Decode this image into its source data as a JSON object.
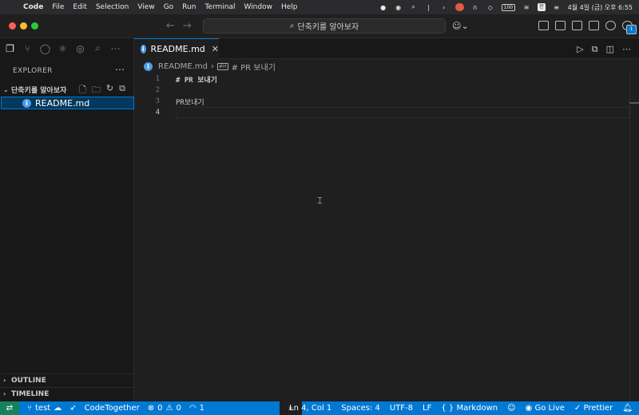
{
  "menubar": {
    "items": [
      "Code",
      "File",
      "Edit",
      "Selection",
      "View",
      "Go",
      "Run",
      "Terminal",
      "Window",
      "Help"
    ],
    "ime": "한",
    "clock": "4월 4일 (금) 오후 6:55",
    "battery": "100"
  },
  "titlebar": {
    "search_text": "단축키를 알아보자"
  },
  "sidebar": {
    "title": "EXPLORER",
    "folder": "단축키를 알아보자",
    "files": [
      {
        "name": "README.md"
      }
    ],
    "panels": [
      "OUTLINE",
      "TIMELINE"
    ]
  },
  "editor": {
    "tab_label": "README.md",
    "breadcrumb": {
      "file": "README.md",
      "symbol": "# PR 보내기"
    },
    "lines": [
      {
        "num": "1",
        "text": "# PR 보내기"
      },
      {
        "num": "2",
        "text": ""
      },
      {
        "num": "3",
        "text": "PR보내기"
      },
      {
        "num": "4",
        "text": ""
      }
    ]
  },
  "statusbar": {
    "branch": "test",
    "codetogether": "CodeTogether",
    "errors": "0",
    "warnings": "0",
    "ports": "1",
    "position": "Ln 4, Col 1",
    "spaces": "Spaces: 4",
    "encoding": "UTF-8",
    "eol": "LF",
    "language": "Markdown",
    "golive": "Go Live",
    "prettier": "Prettier"
  },
  "colors": {
    "accent": "#0078d4",
    "remote": "#16825d",
    "heading": "#569cd6"
  }
}
